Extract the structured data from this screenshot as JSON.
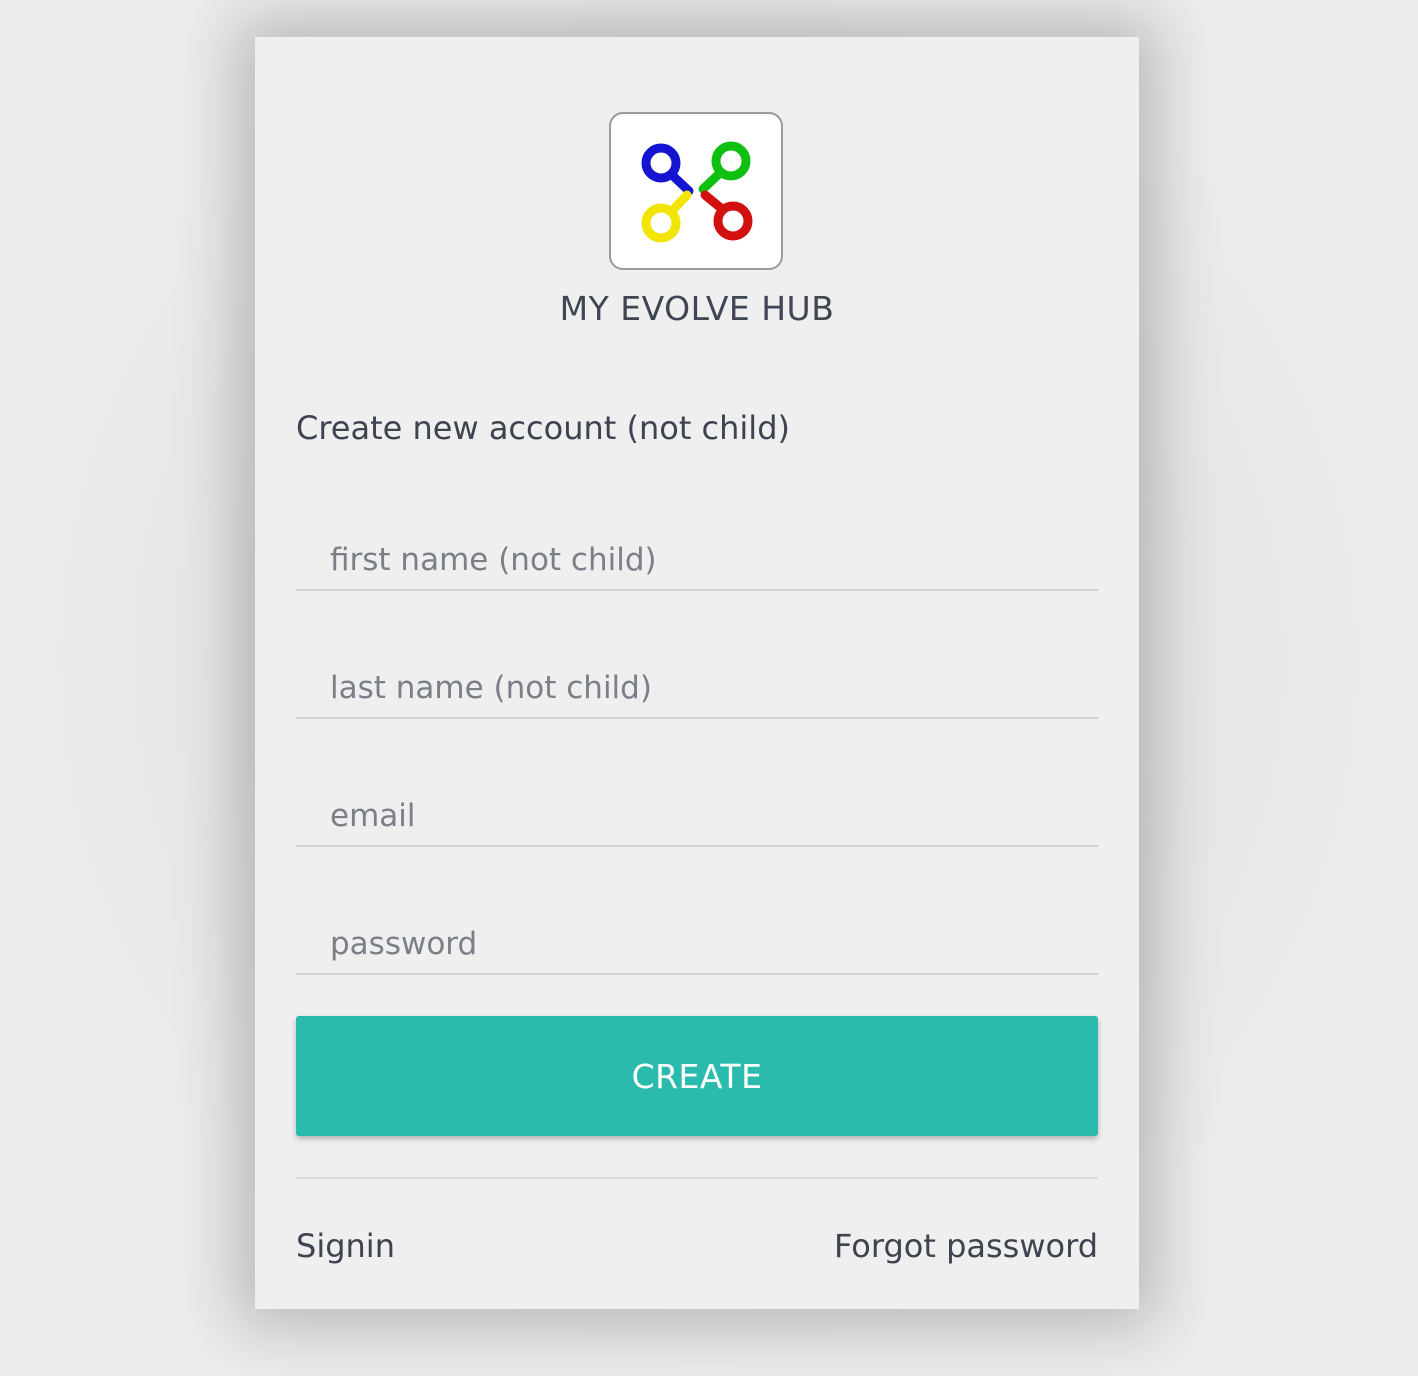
{
  "brand": {
    "logo_icon": "evolve-hub-logo-icon",
    "name": "MY EVOLVE HUB"
  },
  "form": {
    "heading": "Create new account (not child)",
    "first_name_placeholder": "first name (not child)",
    "last_name_placeholder": "last name (not child)",
    "email_placeholder": "email",
    "password_placeholder": "password",
    "create_label": "CREATE"
  },
  "links": {
    "signin": "Signin",
    "forgot_password": "Forgot password"
  },
  "colors": {
    "accent": "#2bbbad",
    "card_background": "#efefef",
    "text": "#3e4350",
    "logo_blue": "#1414d2",
    "logo_green": "#10c010",
    "logo_yellow": "#f2e600",
    "logo_red": "#d21010"
  }
}
